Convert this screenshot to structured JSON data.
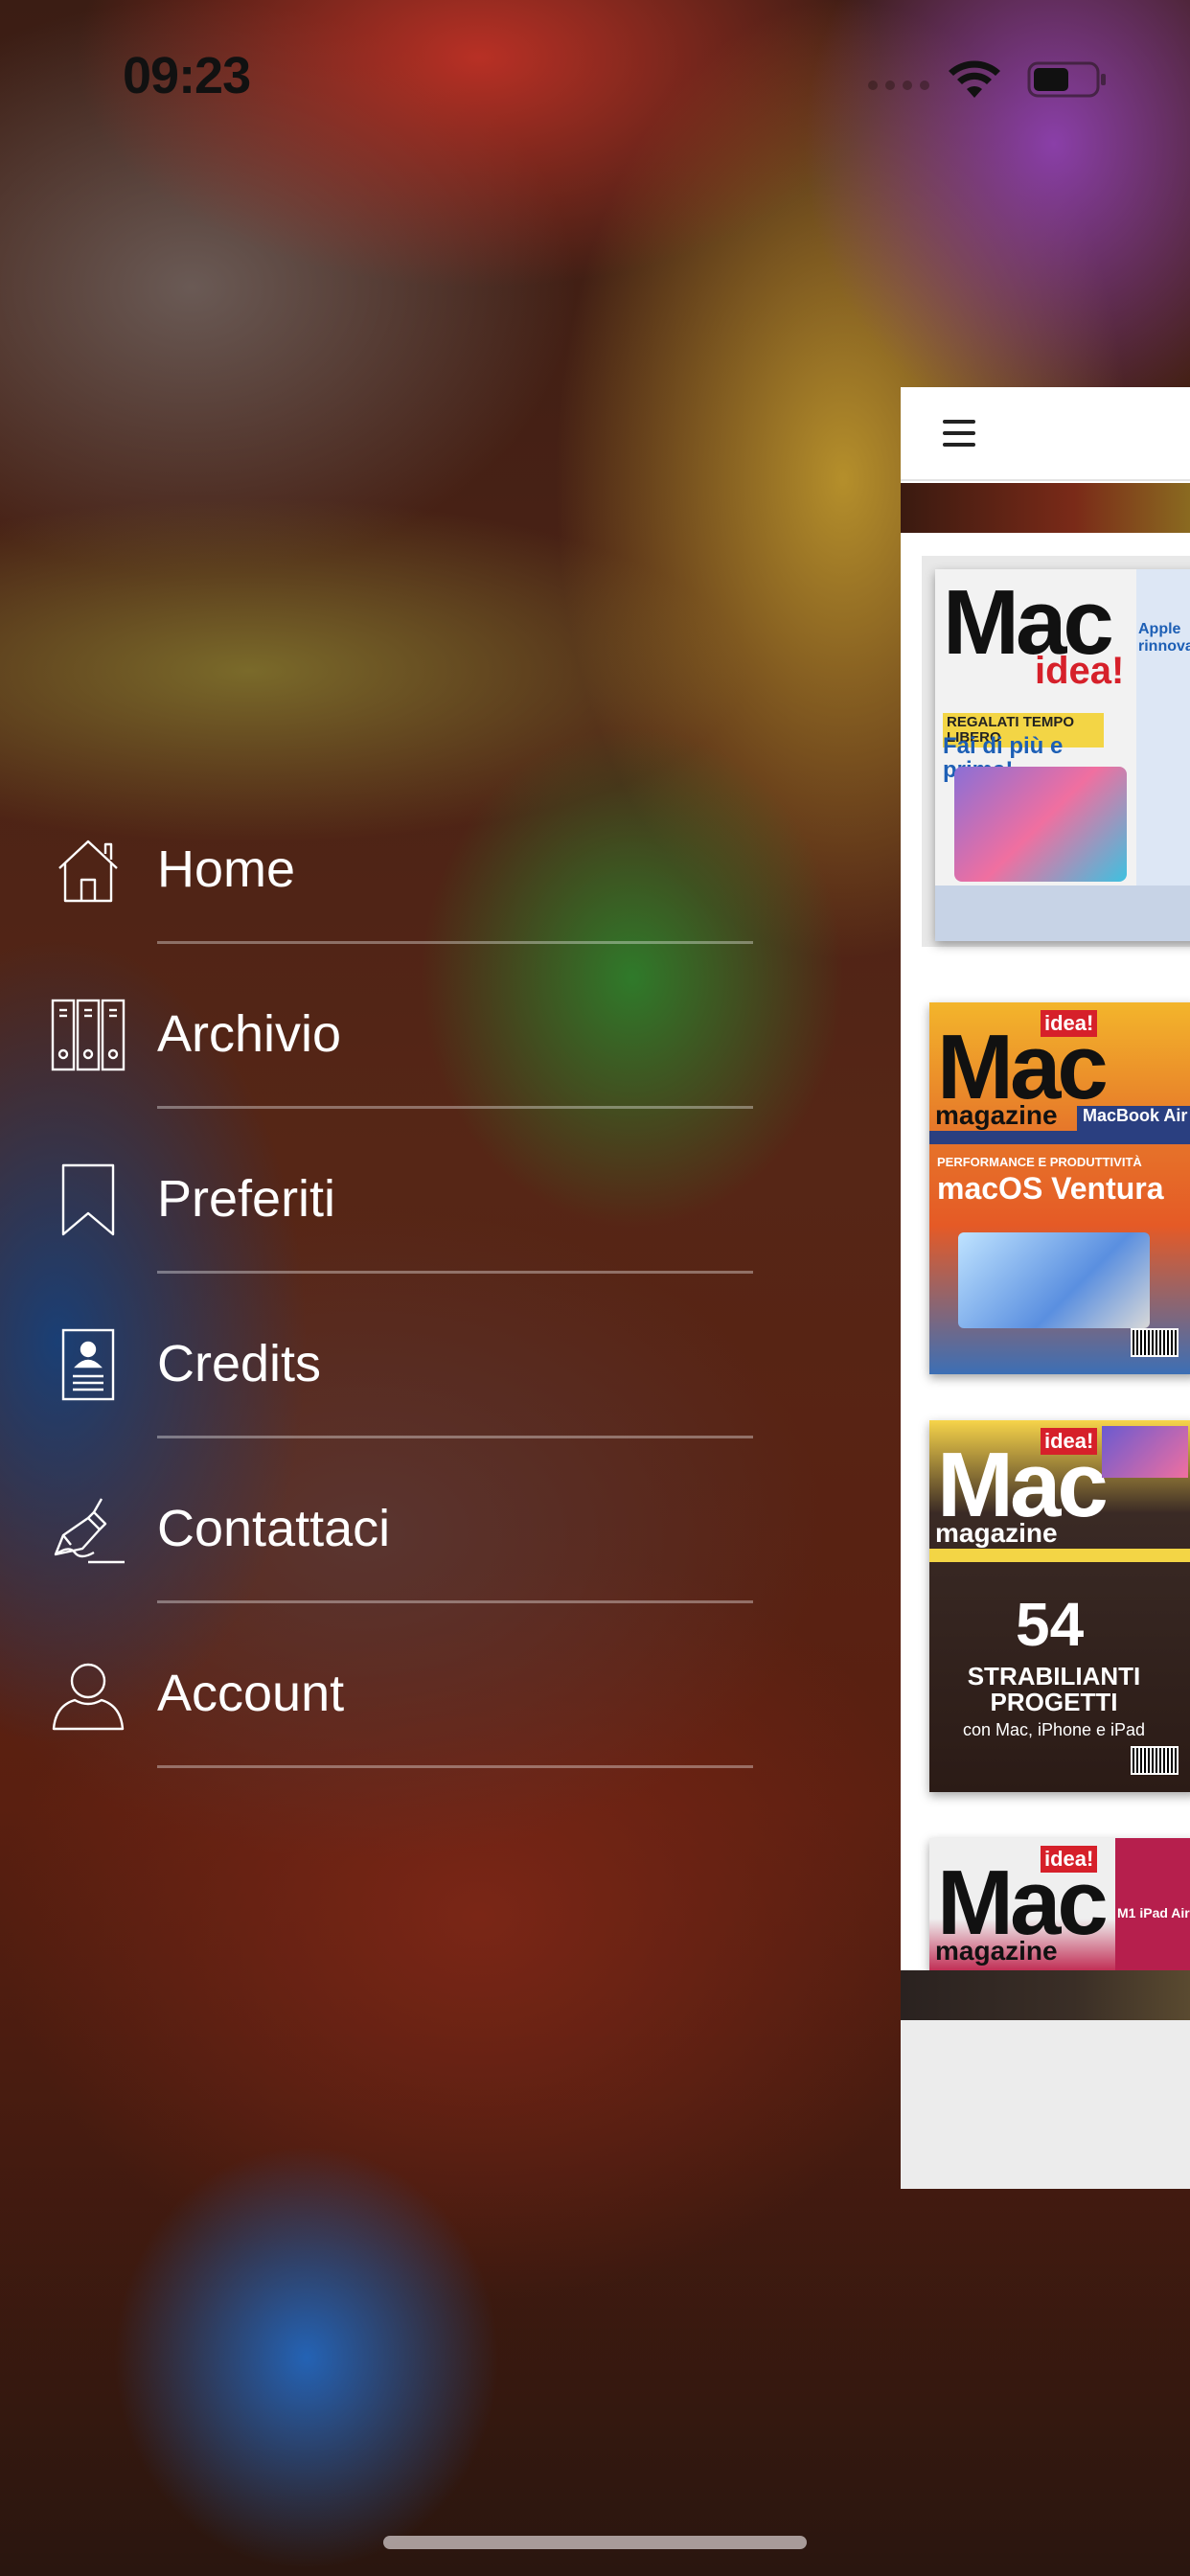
{
  "status_bar": {
    "time": "09:23"
  },
  "menu": {
    "items": [
      {
        "label": "Home",
        "icon": "home-icon"
      },
      {
        "label": "Archivio",
        "icon": "archive-binders-icon"
      },
      {
        "label": "Preferiti",
        "icon": "bookmark-icon"
      },
      {
        "label": "Credits",
        "icon": "credits-document-icon"
      },
      {
        "label": "Contattaci",
        "icon": "pen-signature-icon"
      },
      {
        "label": "Account",
        "icon": "user-icon"
      }
    ]
  },
  "covers": [
    {
      "title_a": "Mac",
      "title_b": "idea!",
      "headline": "Fai di più e prima!",
      "kicker": "REGALATI TEMPO LIBERO",
      "side": "Apple rinnova"
    },
    {
      "badge": "idea!",
      "title_a": "Mac",
      "title_b": "magazine",
      "headline": "macOS Ventura",
      "kicker": "PERFORMANCE E PRODUTTIVITÀ",
      "side": "MacBook Air"
    },
    {
      "badge": "idea!",
      "title_a": "Mac",
      "title_b": "magazine",
      "number": "54",
      "headline": "STRABILIANTI PROGETTI",
      "sub": "con Mac, iPhone e iPad"
    },
    {
      "badge": "idea!",
      "title_a": "Mac",
      "title_b": "magazine",
      "side": "M1 iPad Air"
    }
  ]
}
